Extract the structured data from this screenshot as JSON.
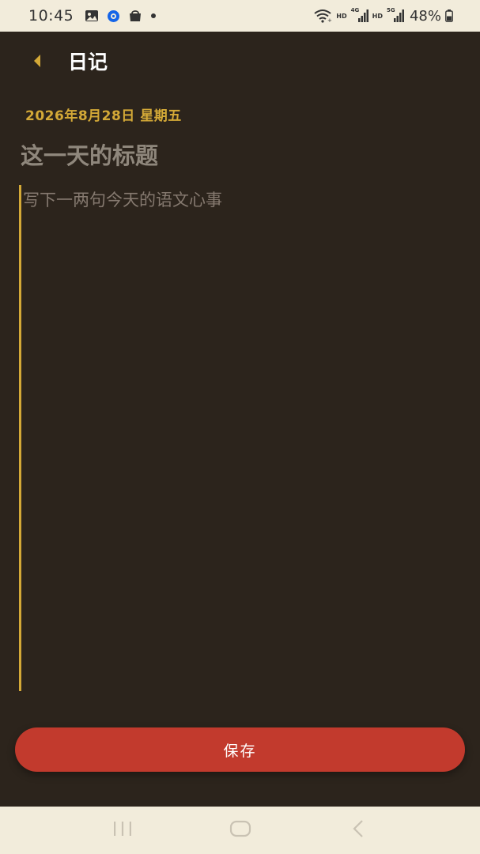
{
  "status_bar": {
    "time": "10:45",
    "network_hd_1": "HD",
    "network_4g": "4G",
    "network_hd_2": "HD",
    "network_5g": "5G",
    "battery": "48%"
  },
  "header": {
    "title": "日记"
  },
  "entry": {
    "date": "2026年8月28日 星期五",
    "title_placeholder": "这一天的标题",
    "body_placeholder": "写下一两句今天的语文心事"
  },
  "actions": {
    "save_label": "保存"
  },
  "colors": {
    "background": "#2c241c",
    "accent": "#d4a937",
    "save_button": "#c23a2d",
    "system_bars": "#f2ecdb"
  },
  "icons": {
    "back": "back-arrow-icon",
    "nav_recents": "recents-icon",
    "nav_home": "home-icon",
    "nav_back": "nav-back-icon"
  }
}
